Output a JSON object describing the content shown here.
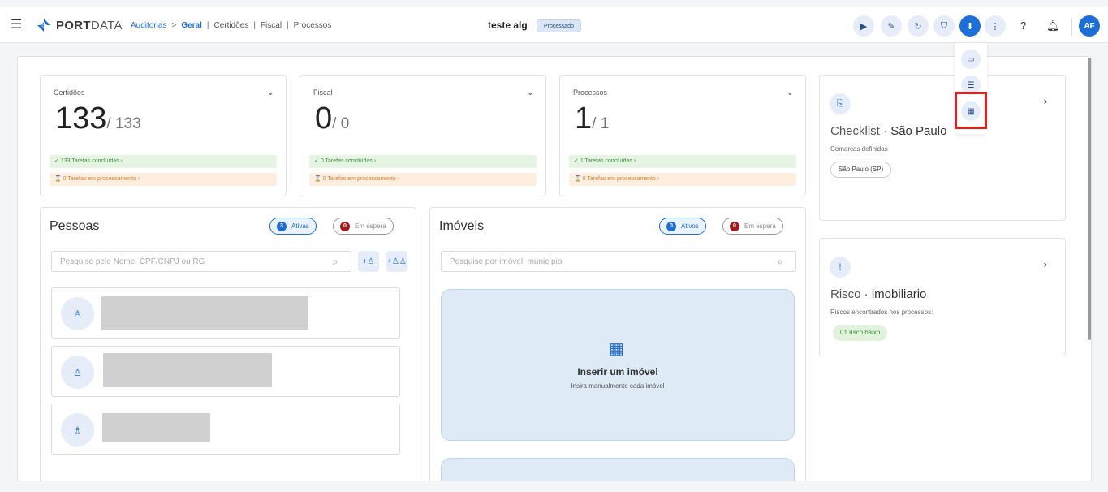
{
  "header": {
    "logo_bold": "PORT",
    "logo_light": "DATA",
    "breadcrumbs": {
      "auditorias": "Auditorias",
      "arrow": ">",
      "geral": "Geral",
      "certidoes": "Certidões",
      "fiscal": "Fiscal",
      "processos": "Processos",
      "sep": "|"
    },
    "title": "teste alg",
    "status_badge": "Processado",
    "avatar": "AF",
    "icons": [
      "play-icon",
      "edit-icon",
      "refresh-icon",
      "shield-check-icon",
      "download-icon",
      "more-vertical-icon",
      "help-icon",
      "bell-icon"
    ]
  },
  "stats": [
    {
      "label": "Certidões",
      "value": "133",
      "total": "/ 133",
      "done": "133 Tarefas concluídas",
      "processing": "0 Tarefas em processamento"
    },
    {
      "label": "Fiscal",
      "value": "0",
      "total": "/ 0",
      "done": "0 Tarefas concluídas",
      "processing": "0 Tarefas em processamento"
    },
    {
      "label": "Processos",
      "value": "1",
      "total": "/ 1",
      "done": "1 Tarefas concluídas",
      "processing": "0 Tarefas em processamento"
    }
  ],
  "pessoas": {
    "title": "Pessoas",
    "active_count": "3",
    "active_label": "Ativas",
    "waiting_count": "0",
    "waiting_label": "Em espera",
    "search_placeholder": "Pesquise pelo Nome, CPF/CNPJ ou RG"
  },
  "imoveis": {
    "title": "Imóveis",
    "active_count": "0",
    "active_label": "Ativos",
    "waiting_count": "0",
    "waiting_label": "Em espera",
    "search_placeholder": "Pesquise por imóvel, município",
    "insert_title": "Inserir um imóvel",
    "insert_subtitle": "Insira manualmente cada imóvel"
  },
  "checklist": {
    "title_prefix": "Checklist ·",
    "title_main": "São Paulo",
    "subtitle": "Comarcas definidas",
    "chip": "São Paulo (SP)"
  },
  "risco": {
    "title_prefix": "Risco ·",
    "title_main": "imobiliario",
    "subtitle": "Riscos encontrados nos processos:",
    "chip": "01 risco baixo"
  },
  "download_menu": [
    "folder-icon",
    "document-list-icon",
    "spreadsheet-icon"
  ],
  "colors": {
    "accent": "#1d6fd6",
    "success": "#3b8e3a",
    "warning": "#d9832c",
    "danger": "#a31a1a",
    "highlight": "#e0201c"
  }
}
